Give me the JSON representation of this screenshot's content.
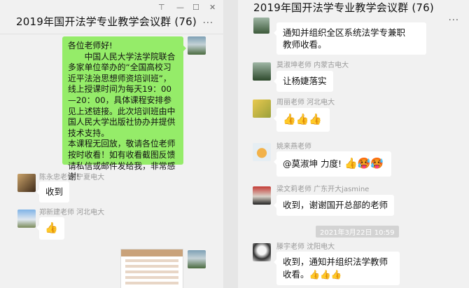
{
  "left": {
    "title": "2019年国开法学专业教学会议群 (76)",
    "more": "···",
    "window_controls": {
      "pin": "⊤",
      "minimize": "—",
      "maximize": "☐",
      "close": "✕"
    },
    "message_green_lines": [
      "各位老师好!",
      "中国人民大学法学院联合多家单位举办的“全国高校习近平法治思想师资培训班”，线上授课时间为每天19：00—20：00，具体课程安排参见上述链接。此次培训班由中国人民大学出版社协办并提供技术支持。",
      "本课程无回放，敬请各位老师按时收看！如有收看截图反馈请私信或邮件发给我，非常感谢!"
    ],
    "msg1_sender": "陈永忠老师  宁夏电大",
    "msg1_text": "收到",
    "msg2_sender": "郑新建老师 河北电大",
    "msg2_emoji": "👍"
  },
  "right": {
    "title": "2019年国开法学专业教学会议群 (76)",
    "more": "···",
    "msg0_text": "通知并组织全区系统法学专兼职教师收看。",
    "msg0_line1": "通知并组织全区系统法学专兼职",
    "msg0_line2": "教师收看。",
    "msg1_sender": "莫淑坤老师 内蒙古电大",
    "msg1_text": "让杨婕落实",
    "msg2_sender": "周丽老师  河北电大",
    "msg2_emoji": "👍👍👍",
    "msg3_sender": "姚来燕老师",
    "msg3_text": "@莫淑坤  力度!",
    "msg3_emoji": "👍🥵🥵",
    "msg4_sender": "梁文莉老师 广东开大jasmine",
    "msg4_text": "收到，谢谢国开总部的老师",
    "timestamp": "2021年3月22日 10:59",
    "msg5_sender": "滕宇老师 沈阳电大",
    "msg5_text": "收到，通知并组织法学教师收看",
    "msg5_tail": "。👍👍👍"
  }
}
